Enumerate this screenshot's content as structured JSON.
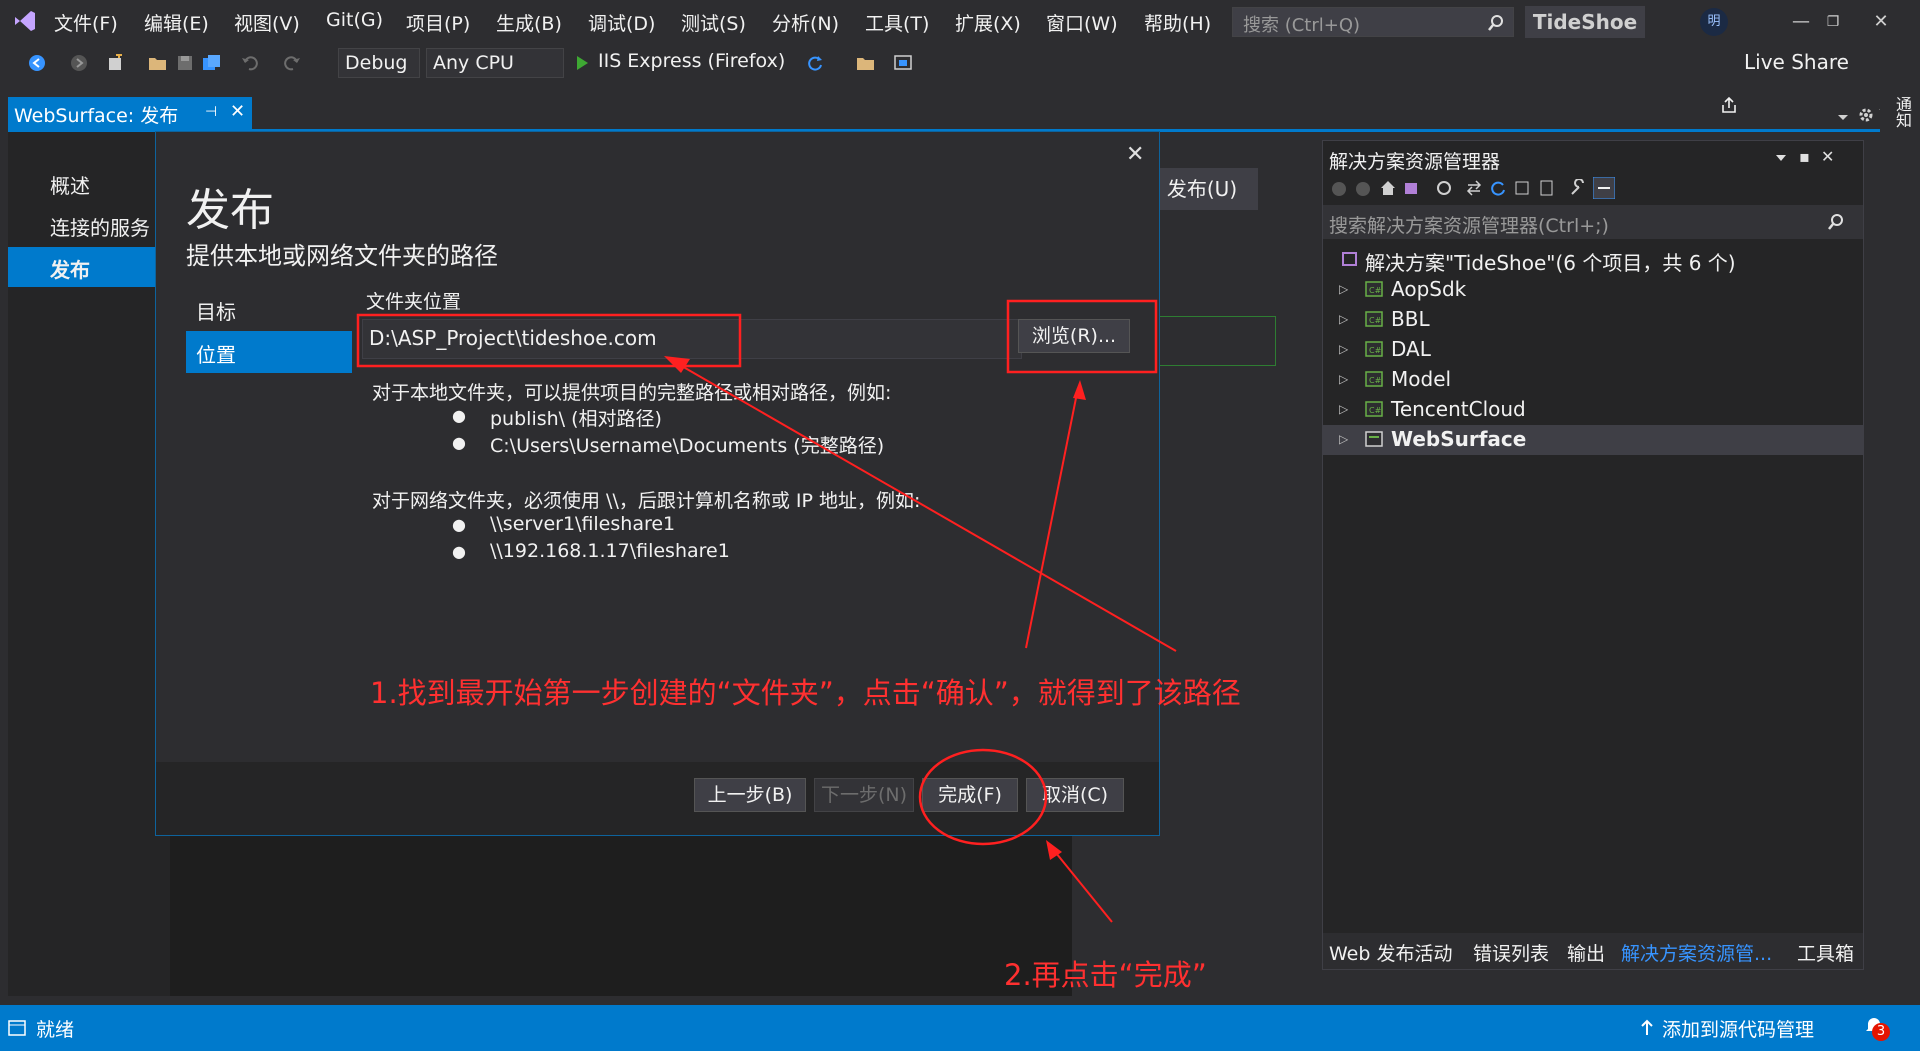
{
  "menubar": {
    "items": [
      "文件(F)",
      "编辑(E)",
      "视图(V)",
      "Git(G)",
      "项目(P)",
      "生成(B)",
      "调试(D)",
      "测试(S)",
      "分析(N)",
      "工具(T)",
      "扩展(X)",
      "窗口(W)",
      "帮助(H)"
    ],
    "search_placeholder": "搜索 (Ctrl+Q)",
    "solution_name": "TideShoe",
    "avatar_initial": "明"
  },
  "toolbar": {
    "config": "Debug",
    "platform": "Any CPU",
    "run_target": "IIS Express (Firefox)",
    "live_share": "Live Share"
  },
  "doc_tab": {
    "label": "WebSurface: 发布"
  },
  "publish_page": {
    "nav": [
      "概述",
      "连接的服务",
      "发布"
    ],
    "publish_button": "发布(U)"
  },
  "dialog": {
    "title": "发布",
    "subtitle": "提供本地或网络文件夹的路径",
    "nav_target": "目标",
    "nav_location": "位置",
    "folder_label": "文件夹位置",
    "folder_value": "D:\\ASP_Project\\tideshoe.com",
    "browse_button": "浏览(R)...",
    "help_local": "对于本地文件夹，可以提供项目的完整路径或相对路径，例如:",
    "local_examples": [
      "publish\\ (相对路径)",
      "C:\\Users\\Username\\Documents (完整路径)"
    ],
    "help_network": "对于网络文件夹，必须使用 \\\\，后跟计算机名称或 IP 地址，例如:",
    "network_examples": [
      "\\\\server1\\fileshare1",
      "\\\\192.168.1.17\\fileshare1"
    ],
    "back_button": "上一步(B)",
    "next_button": "下一步(N)",
    "finish_button": "完成(F)",
    "cancel_button": "取消(C)"
  },
  "solution_explorer": {
    "title": "解决方案资源管理器",
    "search_placeholder": "搜索解决方案资源管理器(Ctrl+;)",
    "solution_label": "解决方案\"TideShoe\"(6 个项目，共 6 个)",
    "projects": [
      "AopSdk",
      "BBL",
      "DAL",
      "Model",
      "TencentCloud",
      "WebSurface"
    ],
    "bottom_tabs": [
      "Web 发布活动",
      "错误列表",
      "输出",
      "解决方案资源管...",
      "工具箱"
    ]
  },
  "notifications_label": "通知",
  "statusbar": {
    "status": "就绪",
    "source_control": "添加到源代码管理",
    "notification_count": "3"
  },
  "annotations": {
    "step1": "1.找到最开始第一步创建的“文件夹”，点击“确认”，就得到了该路径",
    "step2": "2.再点击“完成”"
  },
  "colors": {
    "accent": "#007acc",
    "annotation": "#ff3030",
    "background": "#2d2d30"
  }
}
